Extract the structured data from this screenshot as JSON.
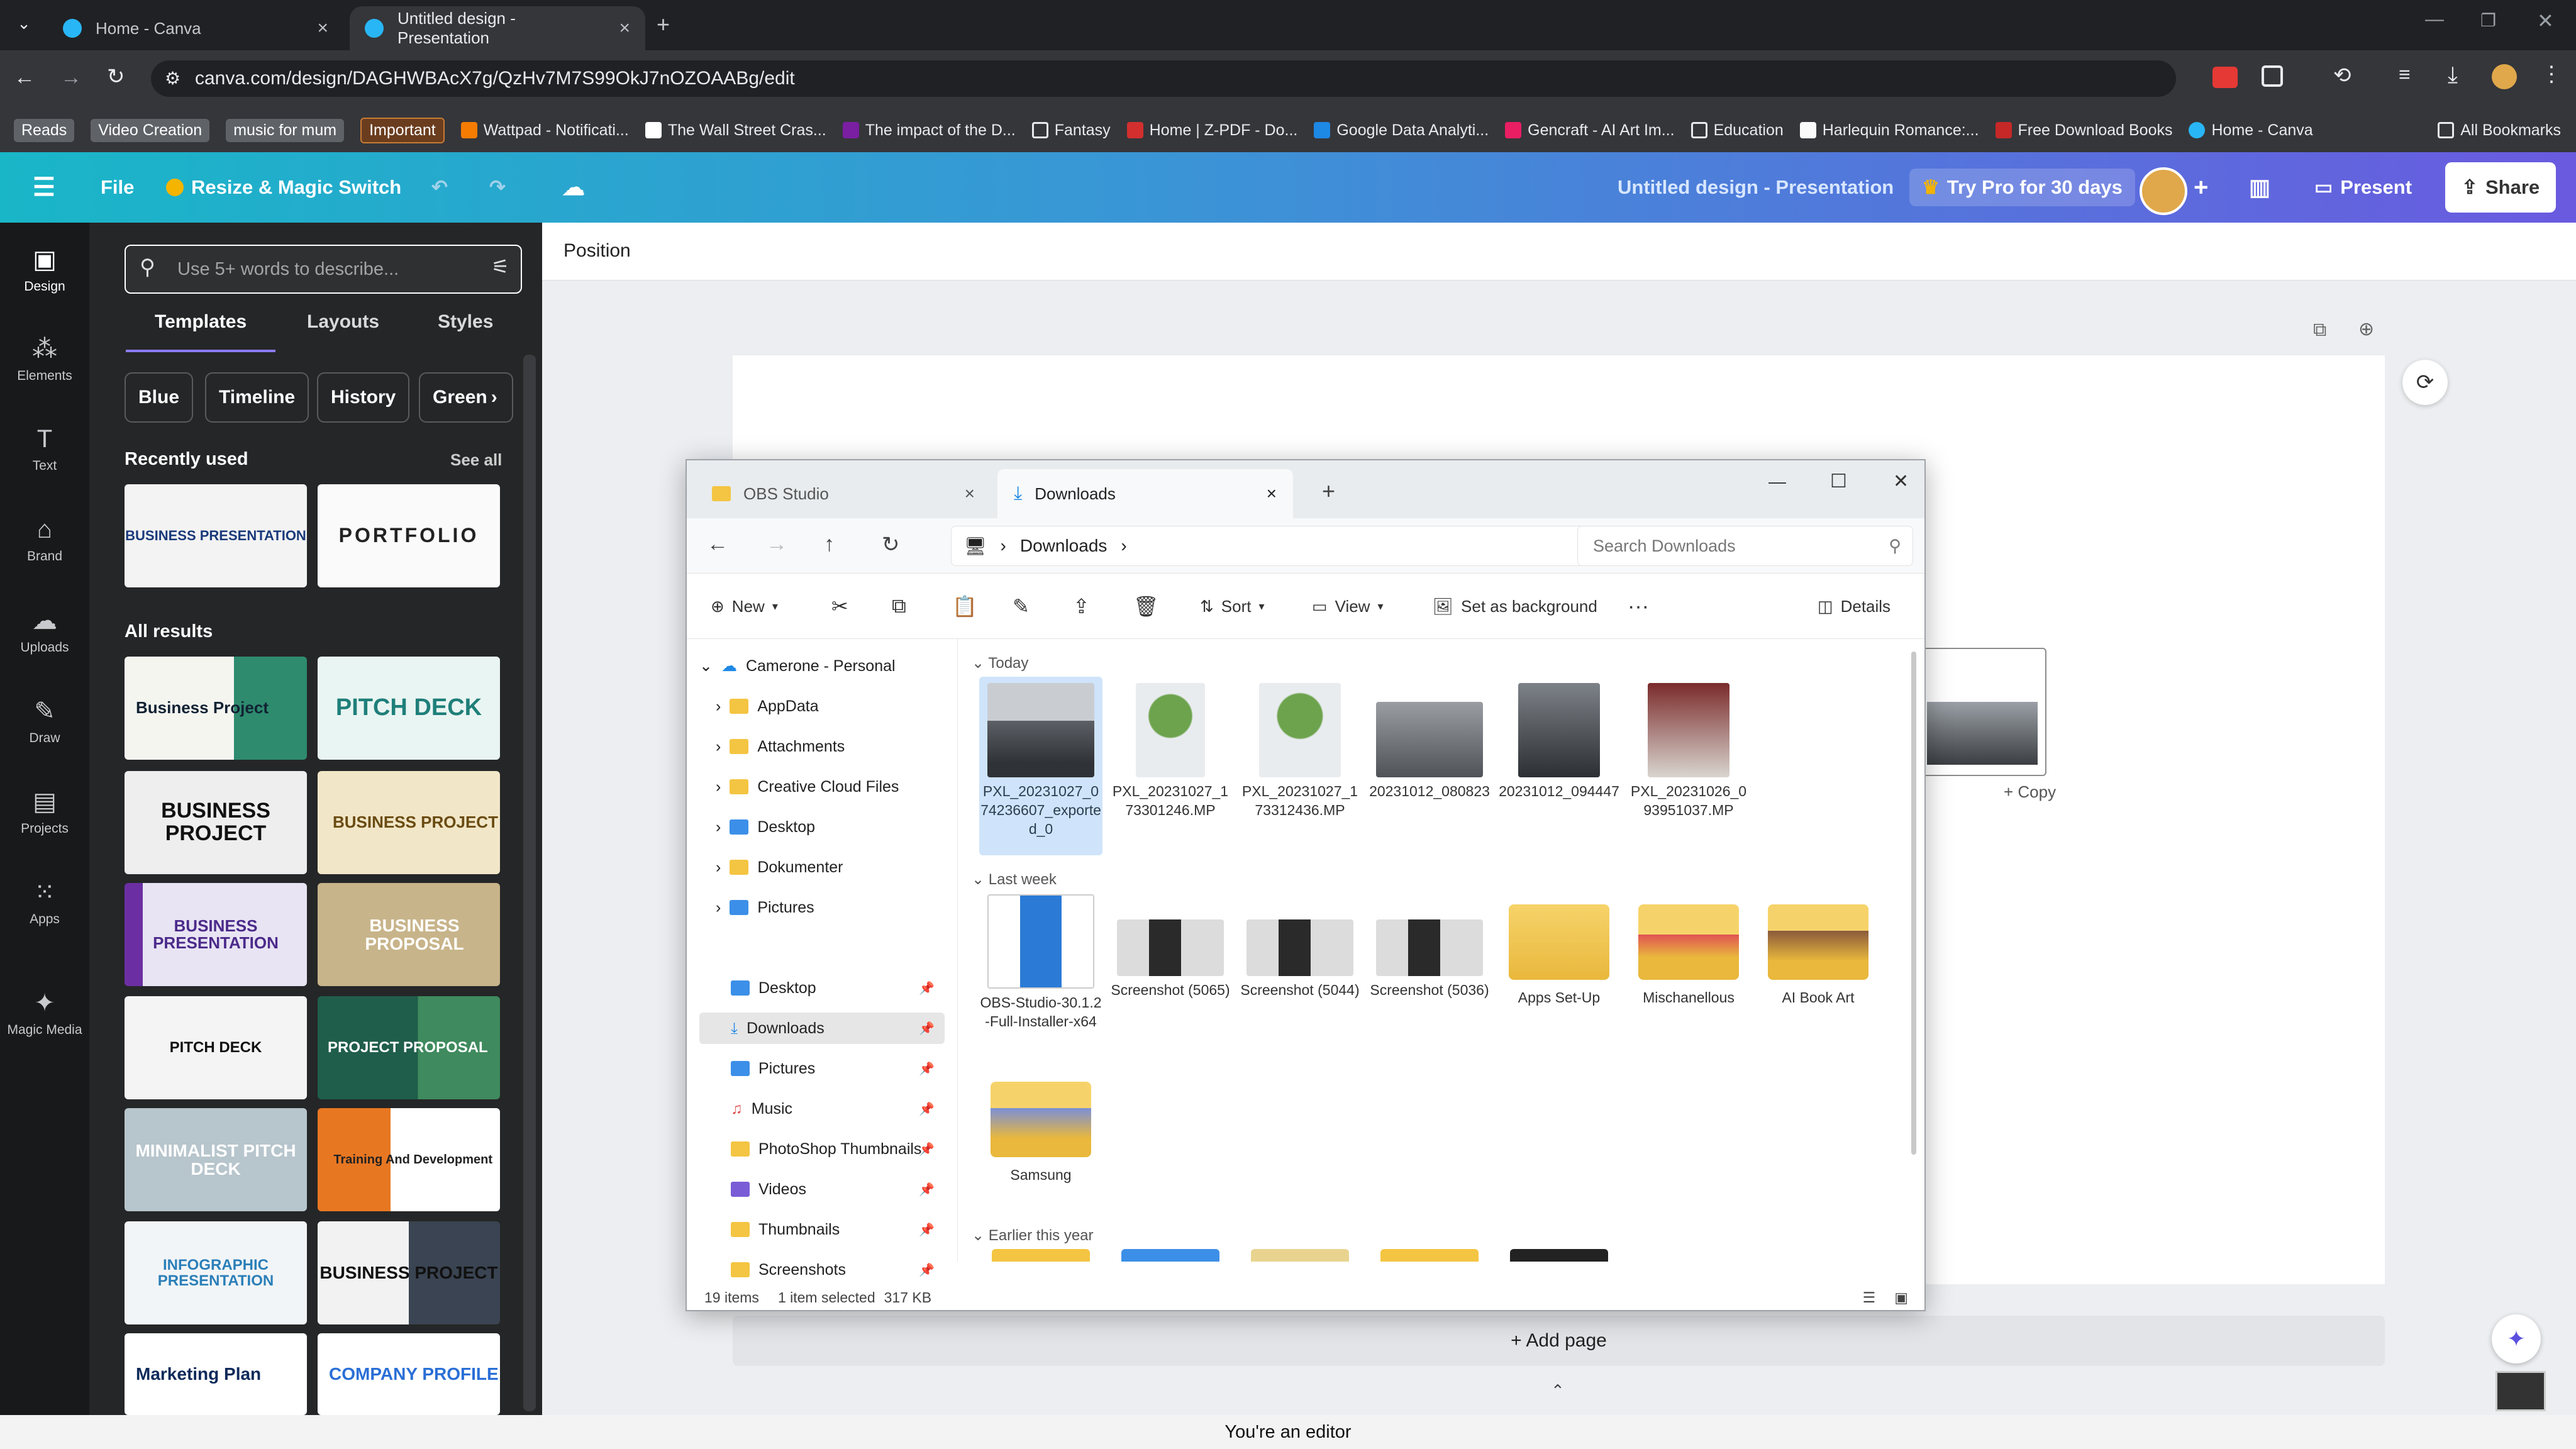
{
  "browser": {
    "tabs": [
      {
        "label": "Home - Canva",
        "active": false
      },
      {
        "label": "Untitled design - Presentation",
        "active": true
      }
    ],
    "url": "canva.com/design/DAGHWBAcX7g/QzHv7M7S99OkJ7nOZOAABg/edit",
    "bookmarks": [
      "Reads",
      "Video Creation",
      "music for mum",
      "Important",
      "Wattpad - Notificati...",
      "The Wall Street Cras...",
      "The impact of the D...",
      "Fantasy",
      "Home | Z-PDF - Do...",
      "Google Data Analyti...",
      "Gencraft - AI Art Im...",
      "Education",
      "Harlequin Romance:...",
      "Free Download Books",
      "Home - Canva"
    ],
    "all_bookmarks": "All Bookmarks"
  },
  "canva_header": {
    "file": "File",
    "resize": "Resize & Magic Switch",
    "doc_title": "Untitled design - Presentation",
    "try_pro": "Try Pro for 30 days",
    "present": "Present",
    "share": "Share"
  },
  "rail": [
    {
      "label": "Design",
      "icon": "design-icon"
    },
    {
      "label": "Elements",
      "icon": "elements-icon"
    },
    {
      "label": "Text",
      "icon": "text-icon"
    },
    {
      "label": "Brand",
      "icon": "brand-icon"
    },
    {
      "label": "Uploads",
      "icon": "uploads-icon"
    },
    {
      "label": "Draw",
      "icon": "draw-icon"
    },
    {
      "label": "Projects",
      "icon": "projects-icon"
    },
    {
      "label": "Apps",
      "icon": "apps-icon"
    },
    {
      "label": "Magic Media",
      "icon": "magic-media-icon"
    }
  ],
  "panel": {
    "search_placeholder": "Use 5+ words to describe...",
    "tabs": [
      "Templates",
      "Layouts",
      "Styles"
    ],
    "chips": [
      "Blue",
      "Timeline",
      "History",
      "Green"
    ],
    "recently_used": "Recently used",
    "see_all": "See all",
    "all_results": "All results",
    "recent_templates": [
      "BUSINESS PRESENTATION",
      "PORTFOLIO"
    ],
    "templates": [
      "Business Project",
      "PITCH DECK",
      "BUSINESS PROJECT",
      "BUSINESS PROJECT",
      "BUSINESS PRESENTATION",
      "BUSINESS PROPOSAL",
      "PITCH DECK",
      "PROJECT PROPOSAL",
      "MINIMALIST PITCH DECK",
      "Training And Development",
      "INFOGRAPHIC PRESENTATION",
      "BUSINESS PROJECT",
      "Marketing Plan",
      "COMPANY PROFILE"
    ]
  },
  "editor": {
    "position": "Position",
    "add_page": "+ Add page",
    "status": "You're an editor",
    "drag_copy": "+ Copy"
  },
  "explorer": {
    "tabs": [
      "OBS Studio",
      "Downloads"
    ],
    "breadcrumb": "Downloads",
    "search_placeholder": "Search Downloads",
    "commands": {
      "new": "New",
      "sort": "Sort",
      "view": "View",
      "set_bg": "Set as background",
      "details": "Details"
    },
    "tree_top": [
      "Camerone - Personal",
      "AppData",
      "Attachments",
      "Creative Cloud Files",
      "Desktop",
      "Dokumenter",
      "Pictures"
    ],
    "quick_access": [
      "Desktop",
      "Downloads",
      "Pictures",
      "Music",
      "PhotoShop Thumbnails",
      "Videos",
      "Thumbnails",
      "Screenshots"
    ],
    "groups": [
      "Today",
      "Last week",
      "Earlier this year"
    ],
    "today": [
      "PXL_20231027_074236607_exported_0",
      "PXL_20231027_173301246.MP",
      "PXL_20231027_173312436.MP",
      "20231012_080823",
      "20231012_094447",
      "PXL_20231026_093951037.MP"
    ],
    "last_week": [
      "OBS-Studio-30.1.2-Full-Installer-x64",
      "Screenshot (5065)",
      "Screenshot (5044)",
      "Screenshot (5036)",
      "Apps Set-Up",
      "Mischanellous",
      "AI Book Art",
      "Samsung"
    ],
    "status": {
      "count": "19 items",
      "selected": "1 item selected",
      "size": "317 KB"
    }
  }
}
